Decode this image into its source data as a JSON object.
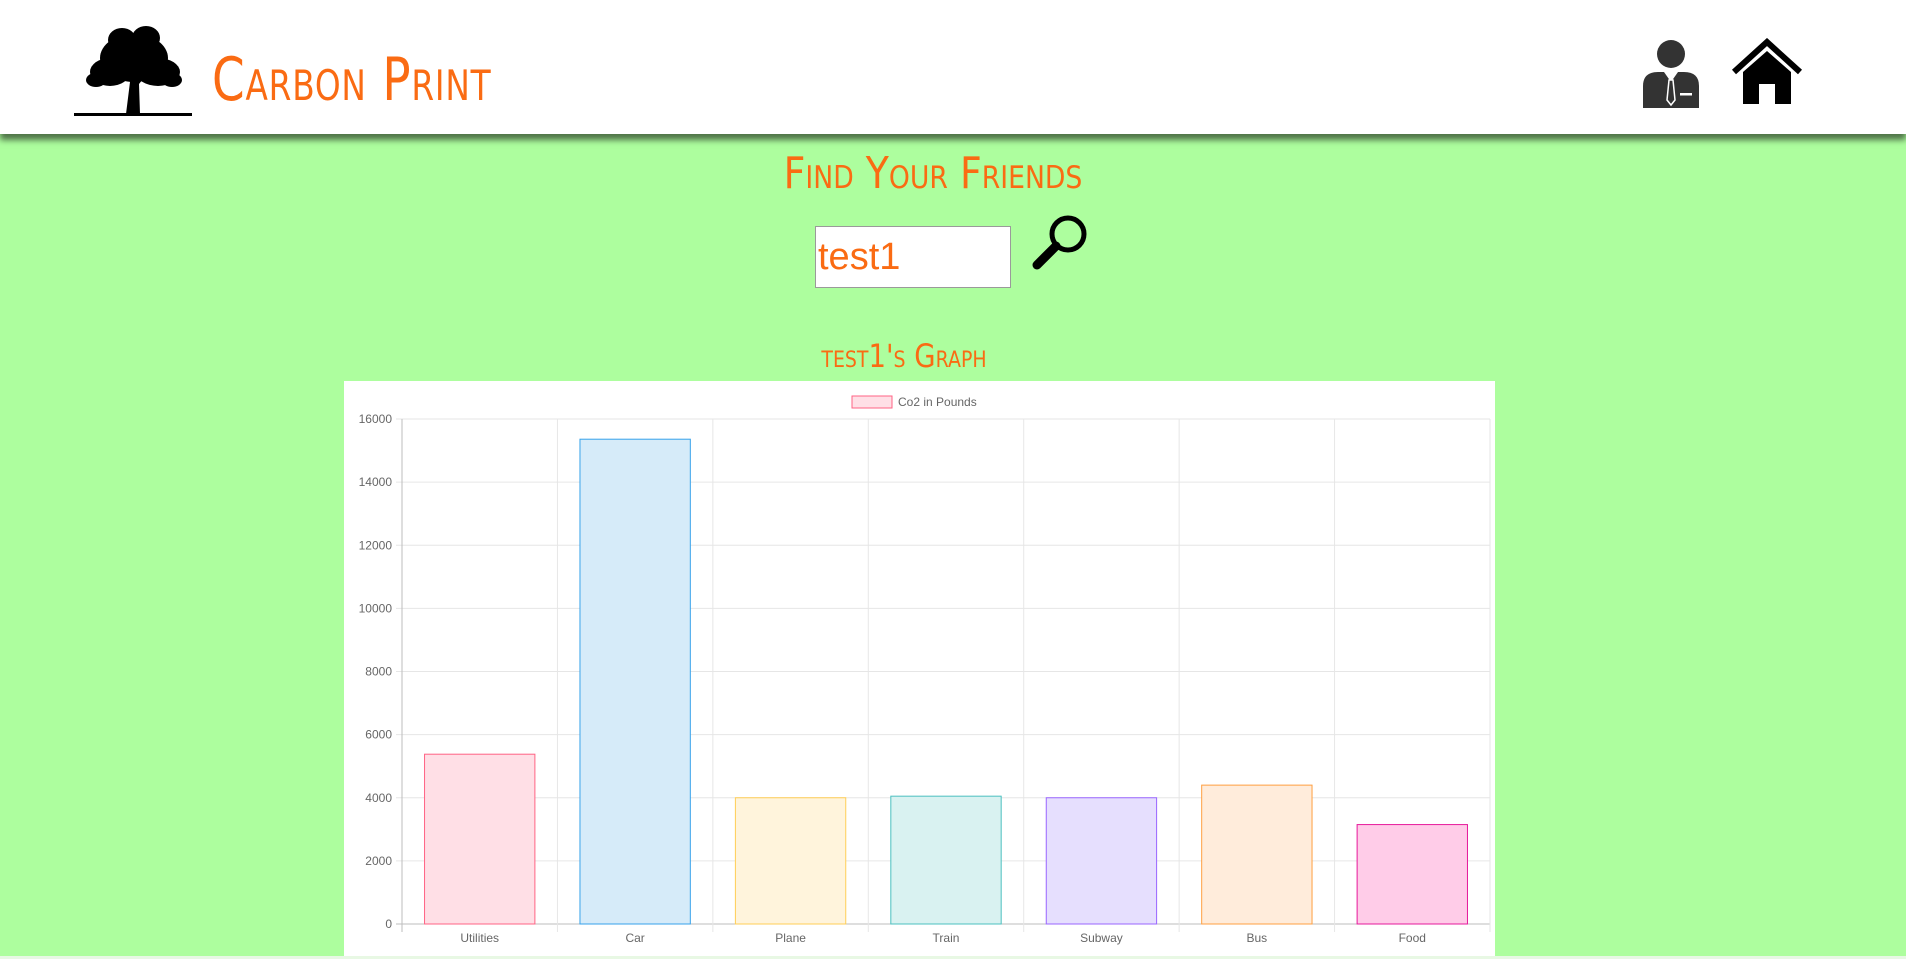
{
  "header": {
    "brand": "Carbon Print",
    "icons": [
      "tree-logo-icon",
      "profile-icon",
      "home-icon"
    ]
  },
  "search": {
    "title": "Find Your Friends",
    "value": "test1",
    "icon": "search-icon"
  },
  "graph": {
    "title": "test1's Graph"
  },
  "colors": {
    "background": "#adfe9e",
    "accent": "#fa6b13"
  },
  "chart_data": {
    "type": "bar",
    "categories": [
      "Utilities",
      "Car",
      "Plane",
      "Train",
      "Subway",
      "Bus",
      "Food"
    ],
    "series": [
      {
        "name": "Co2 in Pounds",
        "values": [
          5380,
          15360,
          4000,
          4050,
          4000,
          4400,
          3150
        ]
      }
    ],
    "ylim": [
      0,
      16000
    ],
    "yticks": [
      0,
      2000,
      4000,
      6000,
      8000,
      10000,
      12000,
      14000,
      16000
    ],
    "grid": true,
    "legend": "top-center",
    "bar_fills": [
      "#ffdfe6",
      "#d6ebf9",
      "#fff4dc",
      "#d9f2f1",
      "#e6dffe",
      "#ffecdb",
      "#ffcce8"
    ],
    "bar_borders": [
      "#ff6384",
      "#36a2eb",
      "#ffce56",
      "#4bc0c0",
      "#9966ff",
      "#ff9f40",
      "#e6189b"
    ]
  }
}
